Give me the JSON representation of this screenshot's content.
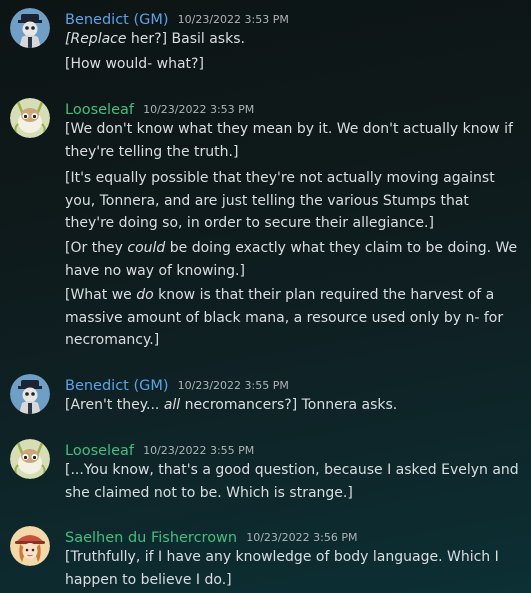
{
  "colors": {
    "gm_name": "#5ba3e8",
    "player_name": "#3fbf7f",
    "text": "#dbdee1",
    "timestamp": "#aeb3b8"
  },
  "messages": [
    {
      "author": "Benedict (GM)",
      "timestamp": "10/23/2022 3:53 PM",
      "avatar_icon": "masked-figure-avatar",
      "lines": [
        {
          "pre": "",
          "em": "[Replace",
          "post": " her?] Basil asks."
        },
        {
          "pre": "[How would- what?]",
          "em": "",
          "post": ""
        }
      ]
    },
    {
      "author": "Looseleaf",
      "timestamp": "10/23/2022 3:53 PM",
      "avatar_icon": "bug-creature-avatar",
      "lines": [
        {
          "pre": "[We don't know what they mean by it. We don't actually know if they're telling the truth.]",
          "em": "",
          "post": ""
        },
        {
          "pre": "[It's equally possible that they're not actually moving against you, Tonnera, and are just telling the various Stumps that they're doing so, in order to secure their allegiance.]",
          "em": "",
          "post": ""
        },
        {
          "pre": "[Or they ",
          "em": "could",
          "post": " be doing exactly what they claim to be doing. We have no way of knowing.]"
        },
        {
          "pre": "[What we ",
          "em": "do",
          "post": " know is that their plan required the harvest of a massive amount of black mana, a resource used only by n- for necromancy.]"
        }
      ]
    },
    {
      "author": "Benedict (GM)",
      "timestamp": "10/23/2022 3:55 PM",
      "avatar_icon": "masked-figure-avatar",
      "lines": [
        {
          "pre": "[Aren't they... ",
          "em": "all",
          "post": " necromancers?] Tonnera asks."
        }
      ]
    },
    {
      "author": "Looseleaf",
      "timestamp": "10/23/2022 3:55 PM",
      "avatar_icon": "bug-creature-avatar",
      "lines": [
        {
          "pre": "[...You know, that's a good question, because I asked Evelyn and she claimed not to be. Which is strange.]",
          "em": "",
          "post": ""
        }
      ]
    },
    {
      "author": "Saelhen du Fishercrown",
      "timestamp": "10/23/2022 3:56 PM",
      "avatar_icon": "hatted-character-avatar",
      "lines": [
        {
          "pre": "[Truthfully, if I have any knowledge of body language. Which I happen to believe I do.]",
          "em": "",
          "post": ""
        }
      ]
    }
  ]
}
